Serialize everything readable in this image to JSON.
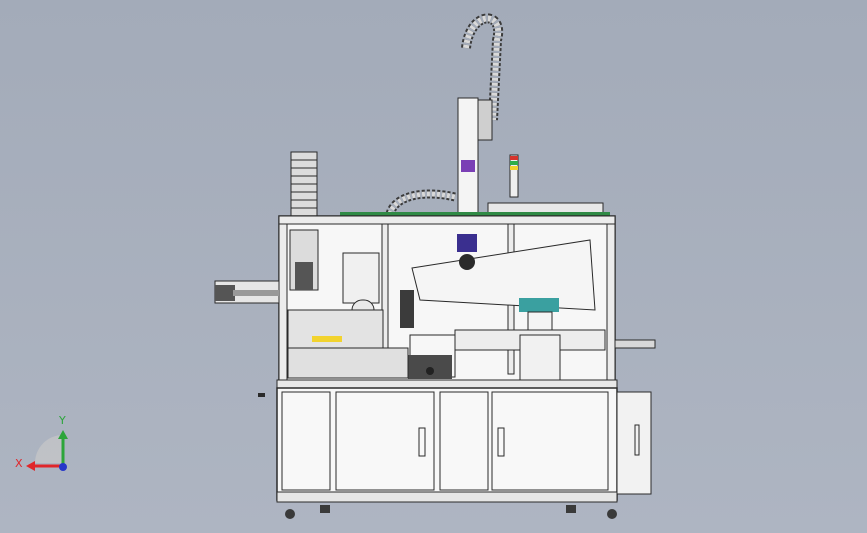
{
  "viewport": {
    "background": "#a7afbd",
    "model_name": "automated-assembly-machine"
  },
  "triad": {
    "x_label": "X",
    "y_label": "Y",
    "x_color": "#e0262a",
    "y_color": "#2ca53a",
    "z_color": "#2637c9"
  },
  "colors": {
    "frame": "#f4f4f4",
    "outline": "#2a2a2a",
    "accent_purple": "#7a3fb5",
    "accent_green": "#2fae4a",
    "accent_teal": "#3aa0a0",
    "accent_yellow": "#f2d32e",
    "accent_red": "#d6342d"
  }
}
